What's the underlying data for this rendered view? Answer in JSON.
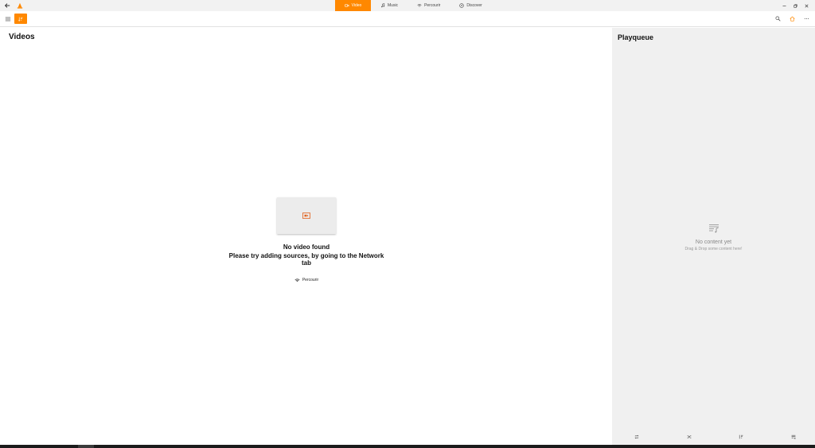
{
  "tabs": [
    {
      "label": "Video",
      "icon": "video-icon",
      "active": true
    },
    {
      "label": "Music",
      "icon": "music-icon",
      "active": false
    },
    {
      "label": "Percourir",
      "icon": "network-icon",
      "active": false
    },
    {
      "label": "Discover",
      "icon": "compass-icon",
      "active": false
    }
  ],
  "main": {
    "title": "Videos",
    "empty_title": "No video found",
    "empty_subtitle": "Please try adding sources, by going to the Network tab",
    "network_link": "Percourir"
  },
  "playqueue": {
    "title": "Playqueue",
    "empty_title": "No content yet",
    "empty_subtitle": "Drag & Drop some content here!"
  },
  "colors": {
    "accent": "#ff8800",
    "sidebar_bg": "#f0f0f0",
    "topbar_bg": "#f2f2f2"
  }
}
